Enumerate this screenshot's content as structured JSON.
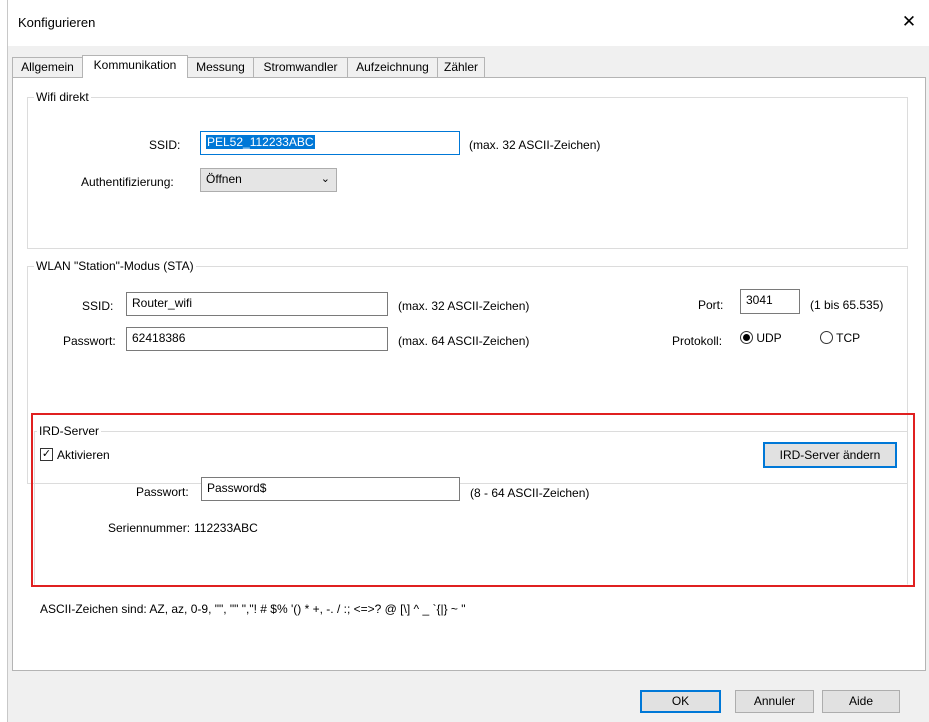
{
  "window": {
    "title": "Konfigurieren",
    "close_label": "✕"
  },
  "tabs": [
    {
      "label": "Allgemein"
    },
    {
      "label": "Kommunikation"
    },
    {
      "label": "Messung"
    },
    {
      "label": "Stromwandler"
    },
    {
      "label": "Aufzeichnung"
    },
    {
      "label": "Zähler"
    }
  ],
  "wifi_direct": {
    "group_label": "Wifi direkt",
    "ssid_label": "SSID:",
    "ssid_value": "PEL52_112233ABC",
    "ssid_hint": "(max. 32 ASCII-Zeichen)",
    "auth_label": "Authentifizierung:",
    "auth_value": "Öffnen"
  },
  "wlan_station": {
    "group_label": "WLAN \"Station\"-Modus (STA)",
    "ssid_label": "SSID:",
    "ssid_value": "Router_wifi",
    "ssid_hint": "(max. 32 ASCII-Zeichen)",
    "password_label": "Passwort:",
    "password_value": "62418386",
    "password_hint": "(max. 64 ASCII-Zeichen)",
    "port_label": "Port:",
    "port_value": "3041",
    "port_hint": "(1 bis 65.535)",
    "protocol_label": "Protokoll:",
    "protocol_udp": "UDP",
    "protocol_tcp": "TCP"
  },
  "ird_server": {
    "group_label": "IRD-Server",
    "activate_label": "Aktivieren",
    "change_button": "IRD-Server ändern",
    "password_label": "Passwort:",
    "password_value": "Password$",
    "password_hint": "(8 - 64 ASCII-Zeichen)",
    "serial_label": "Seriennummer:",
    "serial_value": "112233ABC"
  },
  "ascii_note": "ASCII-Zeichen sind: AZ, az, 0-9, \"\", \"\" \",\"! # $% '() * +, -. / :; <=>? @ [\\] ^ _ `{|} ~ \"",
  "footer": {
    "ok": "OK",
    "cancel": "Annuler",
    "help": "Aide"
  },
  "colors": {
    "highlight": "#e02020",
    "accent": "#0078d7"
  }
}
